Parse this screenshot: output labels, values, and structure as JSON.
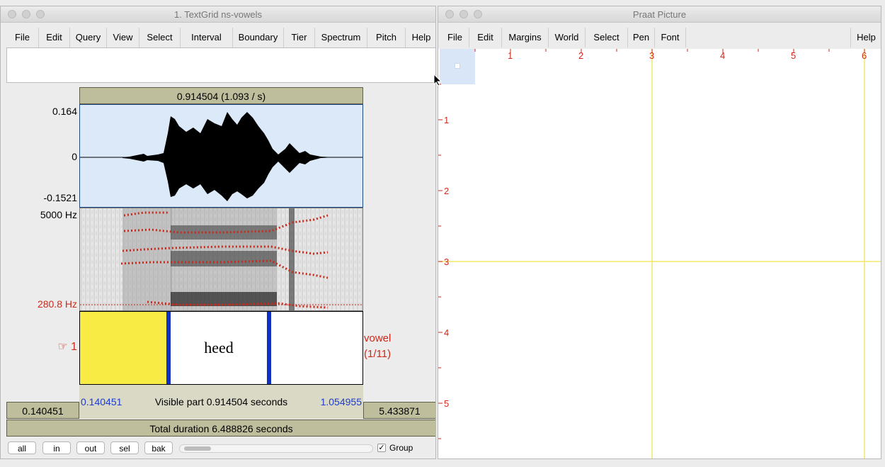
{
  "left_window": {
    "title": "1. TextGrid ns-vowels",
    "menu": [
      "File",
      "Edit",
      "Query",
      "View",
      "Select",
      "Interval",
      "Boundary",
      "Tier",
      "Spectrum",
      "Pitch",
      "Help"
    ],
    "selection_header": "0.914504 (1.093 / s)",
    "waveform": {
      "max_label": "0.164",
      "zero_label": "0",
      "min_label": "-0.1521"
    },
    "spectrogram": {
      "top_label": "5000 Hz",
      "cursor_label": "280.8 Hz"
    },
    "tier": {
      "number_label": "☞ 1",
      "interval_text": "heed",
      "name": "vowel",
      "count": "(1/11)"
    },
    "visible": {
      "start": "0.140451",
      "text": "Visible part 0.914504 seconds",
      "end": "1.054955"
    },
    "left_box": "0.140451",
    "right_box": "5.433871",
    "total_duration": "Total duration 6.488826 seconds",
    "buttons": {
      "all": "all",
      "in": "in",
      "out": "out",
      "sel": "sel",
      "bak": "bak"
    },
    "group_checkbox": {
      "label": "Group",
      "checked": true
    }
  },
  "right_window": {
    "title": "Praat Picture",
    "menu": [
      "File",
      "Edit",
      "Margins",
      "World",
      "Select",
      "Pen",
      "Font",
      "Help"
    ],
    "x_ticks": [
      "1",
      "2",
      "3",
      "4",
      "5",
      "6"
    ],
    "y_ticks": [
      "1",
      "2",
      "3",
      "4",
      "5"
    ]
  },
  "colors": {
    "tan": "#bebd9c",
    "selection": "#dce9f8",
    "tier_selected": "#f8ec44",
    "boundary": "#1030c0",
    "praat_red": "#cc2a1c",
    "praat_yellow": "#f2e96a"
  }
}
